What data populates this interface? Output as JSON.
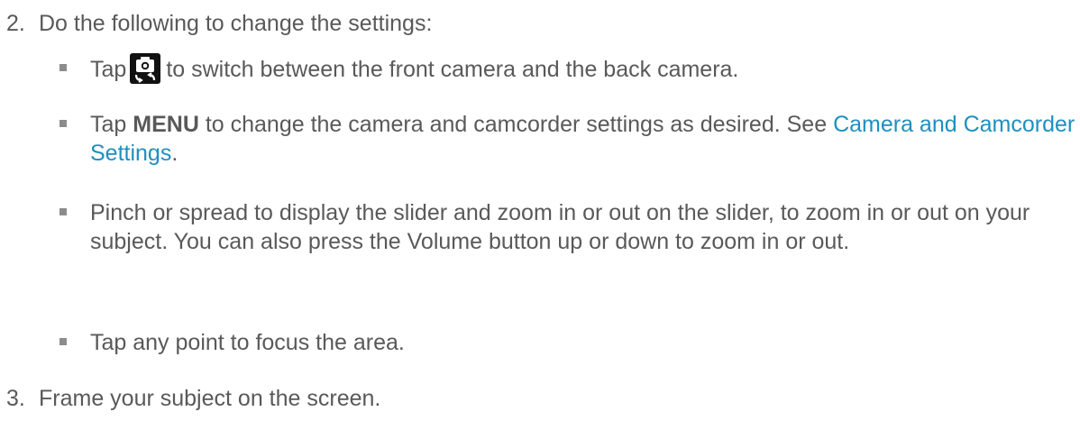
{
  "steps": [
    {
      "number": "2.",
      "text": "Do the following to change the settings:"
    },
    {
      "number": "3.",
      "text": "Frame your subject on the screen."
    }
  ],
  "bullets": [
    {
      "before": "Tap",
      "icon": "camera-switch-icon",
      "after": "to switch between the front camera and the back camera."
    },
    {
      "before": "Tap ",
      "bold": "MENU",
      "middle": " to change the camera and camcorder settings as desired. See ",
      "link": "Camera and Camcorder Settings",
      "end": "."
    },
    {
      "text": "Pinch or spread to display the slider and zoom in or out on the slider, to zoom in or out on your subject. You can also press the Volume button up or down to zoom in or out."
    },
    {
      "text": "Tap any point to focus the area."
    }
  ],
  "colors": {
    "text": "#595959",
    "link": "#1f8fbf",
    "bullet": "#8c8c8c",
    "icon_background": "#111111"
  }
}
